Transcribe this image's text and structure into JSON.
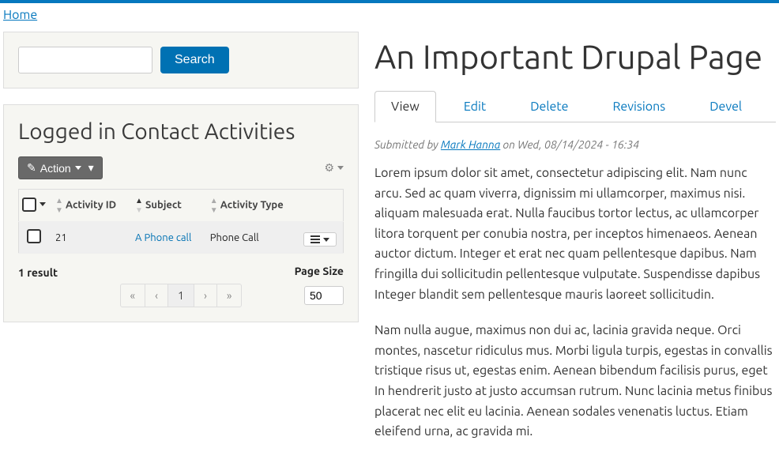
{
  "breadcrumb": {
    "home": "Home"
  },
  "search": {
    "button": "Search"
  },
  "sidebar": {
    "title": "Logged in Contact Activities",
    "action_label": "Action",
    "columns": {
      "id": "Activity ID",
      "subject": "Subject",
      "type": "Activity Type"
    },
    "rows": [
      {
        "id": "21",
        "subject": "A Phone call",
        "type": "Phone Call"
      }
    ],
    "result_count": "1 result",
    "page_size_label": "Page Size",
    "page_size_value": "50",
    "pager": {
      "first": "«",
      "prev": "‹",
      "current": "1",
      "next": "›",
      "last": "»"
    }
  },
  "page": {
    "title": "An Important Drupal Page",
    "tabs": {
      "view": "View",
      "edit": "Edit",
      "delete": "Delete",
      "revisions": "Revisions",
      "devel": "Devel"
    },
    "byline_prefix": "Submitted by ",
    "byline_author": "Mark Hanna",
    "byline_suffix": " on Wed, 08/14/2024 - 16:34",
    "para1": "Lorem ipsum dolor sit amet, consectetur adipiscing elit. Nam nunc arcu. Sed ac quam viverra, dignissim mi ullamcorper, maximus nisi. aliquam malesuada erat. Nulla faucibus tortor lectus, ac ullamcorper litora torquent per conubia nostra, per inceptos himenaeos. Aenean auctor dictum. Integer et erat nec quam pellentesque dapibus. Nam fringilla dui sollicitudin pellentesque vulputate. Suspendisse dapibus Integer blandit sem pellentesque mauris laoreet sollicitudin.",
    "para2": "Nam nulla augue, maximus non dui ac, lacinia gravida neque. Orci montes, nascetur ridiculus mus. Morbi ligula turpis, egestas in convallis tristique risus ut, egestas enim. Aenean bibendum facilisis purus, eget In hendrerit justo at justo accumsan rutrum. Nunc lacinia metus finibus placerat nec elit eu lacinia. Aenean sodales venenatis luctus. Etiam eleifend urna, ac gravida mi."
  }
}
